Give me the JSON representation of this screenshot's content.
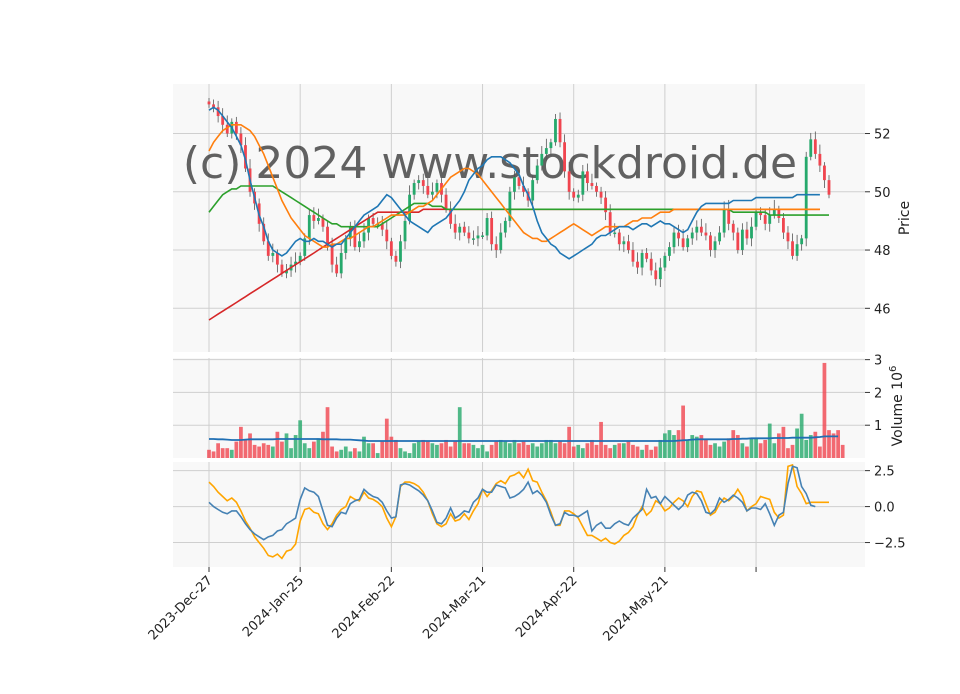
{
  "watermark": "(c) 2024 www.stockdroid.de",
  "colors": {
    "up": "#26a96c",
    "down": "#f0454f",
    "ma_short": "#1f77b4",
    "ma_mid": "#ff7f0e",
    "ma_long": "#2ca02c",
    "ma_longest": "#d62728",
    "volume_avg": "#1f6fb4",
    "macd": "#4682b4",
    "signal": "#ffa500",
    "panel_bg": "#f8f8f8",
    "grid": "#cfcfcf"
  },
  "chart_data": {
    "type": "candlestick",
    "x_ticks": [
      "2023-Dec-27",
      "2024-Jan-25",
      "2024-Feb-22",
      "2024-Mar-21",
      "2024-Apr-22",
      "2024-May-21"
    ],
    "panels": {
      "price": {
        "ylabel": "Price",
        "yticks": [
          46,
          48,
          50,
          52
        ],
        "ylim": [
          44.5,
          53.7
        ],
        "grid": true
      },
      "volume": {
        "ylabel": "Volume  10^6",
        "yticks": [
          1,
          2,
          3
        ],
        "ylim": [
          0,
          3.05
        ],
        "grid": true
      },
      "oscillator": {
        "yticks": [
          "2.5",
          "0.0",
          "−2.5"
        ],
        "ytick_values": [
          2.5,
          0,
          -2.5
        ],
        "ylim": [
          -4.2,
          3.1
        ],
        "grid": true
      }
    },
    "close": [
      53.0,
      52.9,
      52.6,
      52.3,
      52.0,
      52.4,
      52.0,
      51.6,
      50.8,
      50.0,
      49.6,
      48.9,
      48.3,
      47.8,
      47.9,
      47.5,
      47.2,
      47.3,
      47.5,
      47.6,
      47.8,
      48.4,
      49.2,
      49.0,
      49.1,
      48.8,
      48.2,
      47.5,
      47.2,
      47.9,
      48.4,
      48.8,
      48.1,
      48.3,
      48.6,
      49.1,
      48.9,
      48.9,
      48.7,
      48.3,
      47.8,
      47.6,
      48.3,
      49.0,
      49.9,
      50.3,
      50.4,
      50.2,
      49.9,
      50.0,
      50.3,
      49.9,
      49.4,
      48.9,
      48.6,
      48.8,
      48.6,
      48.4,
      48.4,
      48.5,
      48.5,
      49.1,
      48.2,
      48.0,
      48.6,
      49.0,
      50.0,
      50.5,
      50.2,
      50.0,
      49.7,
      50.4,
      50.9,
      51.3,
      51.5,
      51.7,
      52.5,
      51.7,
      50.7,
      50.0,
      49.8,
      49.9,
      50.7,
      50.3,
      50.2,
      50.0,
      49.8,
      49.3,
      48.6,
      48.6,
      48.2,
      48.3,
      48.0,
      47.6,
      47.4,
      47.9,
      47.7,
      47.3,
      47.0,
      47.4,
      47.8,
      48.1,
      48.6,
      48.4,
      48.1,
      48.4,
      48.6,
      48.8,
      48.6,
      48.5,
      48.0,
      48.3,
      48.6,
      49.4,
      48.9,
      48.6,
      48.0,
      48.7,
      48.4,
      48.8,
      49.3,
      49.2,
      48.9,
      49.2,
      49.4,
      49.1,
      48.6,
      48.3,
      47.8,
      48.2,
      48.4,
      51.2,
      51.8,
      51.3,
      50.9,
      50.4,
      49.9
    ],
    "ma_short": [
      52.8,
      52.9,
      52.8,
      52.6,
      52.4,
      52.2,
      51.9,
      51.6,
      51.1,
      50.4,
      49.8,
      49.2,
      48.8,
      48.3,
      48.0,
      47.9,
      47.8,
      47.9,
      48.1,
      48.3,
      48.4,
      48.3,
      48.3,
      48.4,
      48.3,
      48.3,
      48.2,
      48.1,
      48.2,
      48.2,
      48.4,
      48.6,
      48.8,
      49.0,
      49.2,
      49.3,
      49.4,
      49.5,
      49.7,
      49.9,
      49.8,
      49.6,
      49.4,
      49.2,
      49.0,
      48.9,
      48.8,
      48.7,
      48.6,
      48.8,
      48.9,
      49.0,
      49.1,
      49.3,
      49.5,
      49.7,
      50.0,
      50.4,
      50.6,
      50.8,
      50.9,
      51.1,
      51.2,
      51.2,
      51.2,
      51.1,
      51.0,
      50.8,
      50.6,
      50.2,
      49.9,
      49.5,
      49.0,
      48.6,
      48.4,
      48.2,
      48.1,
      47.9,
      47.8,
      47.7,
      47.8,
      47.9,
      48.0,
      48.1,
      48.2,
      48.4,
      48.5,
      48.5,
      48.6,
      48.7,
      48.8,
      48.8,
      48.8,
      48.7,
      48.8,
      48.9,
      48.9,
      48.8,
      48.9,
      49.0,
      48.9,
      48.9,
      48.8,
      48.7,
      48.6,
      48.7,
      49.0,
      49.3,
      49.5,
      49.6,
      49.6,
      49.6,
      49.6,
      49.6,
      49.6,
      49.7,
      49.7,
      49.7,
      49.7,
      49.7,
      49.8,
      49.8,
      49.8,
      49.8,
      49.8,
      49.8,
      49.8,
      49.8,
      49.8,
      49.9,
      49.9,
      49.9,
      49.9,
      49.9,
      49.9
    ],
    "ma_mid": [
      51.4,
      51.7,
      51.9,
      52.1,
      52.2,
      52.3,
      52.3,
      52.3,
      52.2,
      52.1,
      51.9,
      51.6,
      51.3,
      50.9,
      50.5,
      50.1,
      49.7,
      49.4,
      49.1,
      48.9,
      48.7,
      48.5,
      48.4,
      48.3,
      48.2,
      48.1,
      48.1,
      48.2,
      48.2,
      48.3,
      48.4,
      48.4,
      48.5,
      48.6,
      48.7,
      48.8,
      48.8,
      48.9,
      49.0,
      49.1,
      49.2,
      49.2,
      49.2,
      49.2,
      49.3,
      49.4,
      49.5,
      49.5,
      49.6,
      49.7,
      49.9,
      50.1,
      50.3,
      50.5,
      50.6,
      50.7,
      50.8,
      50.8,
      50.7,
      50.6,
      50.4,
      50.2,
      50.0,
      49.8,
      49.6,
      49.4,
      49.2,
      49.0,
      48.8,
      48.6,
      48.5,
      48.4,
      48.4,
      48.3,
      48.3,
      48.4,
      48.5,
      48.6,
      48.7,
      48.8,
      48.9,
      48.8,
      48.7,
      48.6,
      48.5,
      48.6,
      48.7,
      48.8,
      48.8,
      48.8,
      48.8,
      48.8,
      48.9,
      49.0,
      49.0,
      49.1,
      49.1,
      49.1,
      49.2,
      49.3,
      49.3,
      49.3,
      49.4,
      49.4,
      49.4,
      49.4,
      49.4,
      49.4,
      49.4,
      49.4,
      49.4,
      49.4,
      49.4,
      49.4,
      49.4,
      49.4,
      49.4,
      49.4,
      49.4,
      49.4,
      49.4,
      49.4,
      49.4,
      49.4,
      49.4,
      49.4,
      49.4,
      49.4,
      49.4,
      49.4,
      49.4,
      49.4,
      49.4,
      49.4,
      49.4
    ],
    "ma_long": [
      49.3,
      49.5,
      49.7,
      49.9,
      50.0,
      50.1,
      50.1,
      50.2,
      50.2,
      50.2,
      50.2,
      50.2,
      50.2,
      50.2,
      50.2,
      50.1,
      50.0,
      49.9,
      49.8,
      49.7,
      49.6,
      49.5,
      49.4,
      49.3,
      49.2,
      49.1,
      49.0,
      48.9,
      48.9,
      48.8,
      48.8,
      48.8,
      48.8,
      48.8,
      48.8,
      48.8,
      48.8,
      48.8,
      48.9,
      49.0,
      49.1,
      49.2,
      49.3,
      49.4,
      49.5,
      49.6,
      49.6,
      49.6,
      49.6,
      49.5,
      49.5,
      49.5,
      49.4,
      49.4,
      49.4,
      49.4,
      49.4,
      49.4,
      49.4,
      49.4,
      49.4,
      49.4,
      49.4,
      49.4,
      49.4,
      49.4,
      49.4,
      49.4,
      49.4,
      49.4,
      49.4,
      49.4,
      49.4,
      49.4,
      49.4,
      49.4,
      49.4,
      49.4,
      49.4,
      49.4,
      49.4,
      49.4,
      49.4,
      49.4,
      49.4,
      49.4,
      49.4,
      49.4,
      49.4,
      49.4,
      49.4,
      49.4,
      49.4,
      49.4,
      49.4,
      49.4,
      49.4,
      49.4,
      49.4,
      49.4,
      49.4,
      49.4,
      49.4,
      49.4,
      49.4,
      49.4,
      49.4,
      49.4,
      49.4,
      49.4,
      49.4,
      49.4,
      49.4,
      49.4,
      49.4,
      49.3,
      49.3,
      49.3,
      49.3,
      49.3,
      49.3,
      49.3,
      49.3,
      49.2,
      49.2,
      49.2,
      49.2,
      49.2,
      49.2,
      49.2,
      49.2,
      49.2,
      49.2,
      49.2,
      49.2,
      49.2,
      49.2
    ],
    "ma_longest": [
      45.6,
      45.7,
      45.8,
      45.9,
      46.0,
      46.1,
      46.2,
      46.3,
      46.4,
      46.5,
      46.6,
      46.7,
      46.8,
      46.9,
      47.0,
      47.1,
      47.2,
      47.3,
      47.4,
      47.5,
      47.6,
      47.7,
      47.8,
      47.9,
      48.0,
      48.1,
      48.2,
      48.3,
      48.4,
      48.5,
      48.6,
      48.7,
      48.8,
      48.9,
      49.0,
      49.1,
      49.2,
      49.3,
      49.3,
      49.3,
      49.3,
      49.3,
      49.3,
      49.3,
      49.3,
      49.3,
      49.3,
      49.4,
      49.4,
      49.4,
      49.4,
      49.4,
      49.4,
      49.4,
      49.4,
      49.4,
      49.4,
      49.4,
      49.4,
      49.4,
      49.4,
      49.4,
      49.4,
      49.4,
      49.4,
      49.4,
      49.4,
      49.4,
      49.4,
      49.4,
      49.4,
      49.4,
      49.4,
      49.4,
      49.4,
      49.4,
      49.4,
      49.4,
      49.4,
      49.4,
      49.4,
      49.4,
      49.4,
      49.4,
      49.4,
      49.4,
      49.4,
      49.4,
      49.4,
      49.4,
      49.4,
      49.4,
      49.4,
      49.4,
      49.4,
      49.4,
      49.4,
      49.4,
      49.4,
      49.4,
      49.4,
      49.4,
      49.4,
      49.4,
      49.4,
      49.4,
      49.4,
      49.4,
      49.4,
      49.4,
      49.4,
      49.4,
      49.4,
      49.4,
      49.4,
      49.4,
      49.4,
      49.4,
      49.4,
      49.4,
      49.4,
      49.4,
      49.4,
      49.4,
      49.4,
      49.4,
      49.4,
      49.4,
      49.4,
      49.4,
      49.4,
      49.4,
      49.4,
      49.4,
      49.4
    ],
    "volume": [
      0.25,
      0.2,
      0.45,
      0.3,
      0.3,
      0.25,
      0.5,
      0.95,
      0.55,
      0.75,
      0.4,
      0.35,
      0.45,
      0.4,
      0.35,
      0.8,
      0.5,
      0.75,
      0.3,
      0.7,
      1.15,
      0.45,
      0.3,
      0.5,
      0.6,
      0.8,
      1.55,
      0.35,
      0.2,
      0.25,
      0.35,
      0.2,
      0.3,
      0.2,
      0.65,
      0.45,
      0.45,
      0.15,
      0.5,
      1.2,
      0.65,
      0.55,
      0.3,
      0.2,
      0.15,
      0.45,
      0.5,
      0.55,
      0.5,
      0.45,
      0.4,
      0.45,
      0.55,
      0.35,
      0.5,
      1.55,
      0.45,
      0.45,
      0.4,
      0.3,
      0.4,
      0.2,
      0.4,
      0.5,
      0.55,
      0.5,
      0.45,
      0.55,
      0.45,
      0.5,
      0.4,
      0.45,
      0.35,
      0.45,
      0.55,
      0.55,
      0.45,
      0.5,
      0.45,
      0.95,
      0.35,
      0.4,
      0.3,
      0.45,
      0.55,
      0.4,
      1.1,
      0.4,
      0.3,
      0.4,
      0.45,
      0.45,
      0.5,
      0.4,
      0.35,
      0.25,
      0.4,
      0.25,
      0.35,
      0.55,
      0.75,
      0.85,
      0.7,
      0.85,
      1.6,
      0.55,
      0.7,
      0.65,
      0.7,
      0.55,
      0.4,
      0.45,
      0.35,
      0.5,
      0.6,
      0.85,
      0.7,
      0.45,
      0.35,
      0.6,
      0.6,
      0.45,
      0.55,
      1.05,
      0.45,
      0.75,
      0.95,
      0.3,
      0.4,
      0.9,
      1.35,
      0.55,
      0.7,
      0.8,
      0.35,
      2.9,
      0.85,
      0.75,
      0.85,
      0.4
    ],
    "volume_avg": [
      0.58,
      0.58,
      0.57,
      0.57,
      0.56,
      0.55,
      0.55,
      0.55,
      0.56,
      0.57,
      0.57,
      0.57,
      0.57,
      0.57,
      0.57,
      0.58,
      0.58,
      0.58,
      0.58,
      0.58,
      0.58,
      0.58,
      0.58,
      0.58,
      0.58,
      0.57,
      0.57,
      0.57,
      0.57,
      0.56,
      0.56,
      0.56,
      0.55,
      0.54,
      0.53,
      0.52,
      0.52,
      0.52,
      0.52,
      0.52,
      0.52,
      0.52,
      0.52,
      0.52,
      0.52,
      0.52,
      0.52,
      0.52,
      0.52,
      0.52,
      0.52,
      0.52,
      0.52,
      0.52,
      0.52,
      0.52,
      0.52,
      0.52,
      0.52,
      0.52,
      0.52,
      0.52,
      0.52,
      0.52,
      0.52,
      0.52,
      0.52,
      0.52,
      0.52,
      0.52,
      0.52,
      0.52,
      0.52,
      0.52,
      0.52,
      0.52,
      0.52,
      0.52,
      0.52,
      0.52,
      0.52,
      0.52,
      0.52,
      0.52,
      0.52,
      0.52,
      0.52,
      0.52,
      0.52,
      0.52,
      0.52,
      0.52,
      0.52,
      0.52,
      0.52,
      0.52,
      0.52,
      0.52,
      0.52,
      0.52,
      0.52,
      0.52,
      0.52,
      0.53,
      0.54,
      0.55,
      0.56,
      0.57,
      0.57,
      0.57,
      0.57,
      0.57,
      0.57,
      0.57,
      0.57,
      0.58,
      0.58,
      0.59,
      0.59,
      0.6,
      0.6,
      0.6,
      0.6,
      0.6,
      0.61,
      0.61,
      0.61,
      0.61,
      0.62,
      0.62,
      0.62,
      0.62,
      0.62,
      0.63,
      0.64,
      0.66,
      0.66,
      0.66,
      0.66
    ],
    "macd": [
      0.3,
      0.0,
      -0.2,
      -0.4,
      -0.5,
      -0.3,
      -0.3,
      -0.7,
      -1.2,
      -1.6,
      -1.9,
      -2.1,
      -2.3,
      -2.1,
      -2.0,
      -1.7,
      -1.6,
      -1.2,
      -1.0,
      -0.8,
      0.5,
      1.3,
      1.1,
      1.0,
      0.7,
      -0.3,
      -1.3,
      -1.4,
      -0.8,
      -0.4,
      -0.5,
      0.2,
      0.4,
      0.5,
      1.2,
      0.9,
      0.7,
      0.6,
      0.3,
      -0.3,
      -0.8,
      -0.7,
      1.5,
      1.6,
      1.5,
      1.3,
      1.1,
      0.8,
      0.4,
      -0.3,
      -1.1,
      -1.2,
      -0.8,
      -0.1,
      -0.8,
      -0.6,
      -0.3,
      -0.4,
      0.3,
      0.6,
      1.2,
      1.0,
      1.0,
      1.5,
      1.4,
      1.3,
      0.6,
      0.7,
      0.9,
      1.2,
      1.7,
      0.9,
      1.1,
      0.8,
      0.3,
      -0.6,
      -1.3,
      -1.2,
      -0.4,
      -0.6,
      -0.6,
      -0.7,
      -0.5,
      -0.3,
      -1.7,
      -1.3,
      -1.1,
      -1.5,
      -1.5,
      -1.2,
      -1.0,
      -1.2,
      -1.3,
      -0.8,
      -0.5,
      -0.2,
      1.2,
      0.6,
      0.7,
      0.2,
      0.7,
      0.4,
      0.1,
      -0.2,
      0.1,
      0.8,
      1.0,
      0.9,
      0.4,
      -0.4,
      -0.5,
      -0.2,
      0.6,
      0.3,
      0.5,
      0.8,
      0.6,
      0.3,
      -0.3,
      -0.1,
      -0.1,
      -0.2,
      0.2,
      -0.5,
      -1.3,
      -0.6,
      -0.4,
      1.6,
      2.8,
      2.7,
      1.4,
      0.9,
      0.1,
      0.0
    ],
    "signal": [
      1.7,
      1.4,
      1.0,
      0.7,
      0.4,
      0.6,
      0.3,
      -0.3,
      -1.0,
      -1.5,
      -2.1,
      -2.5,
      -2.9,
      -3.4,
      -3.5,
      -3.3,
      -3.6,
      -3.1,
      -3.0,
      -2.6,
      -1.0,
      -0.2,
      -0.1,
      -0.4,
      -0.5,
      -1.2,
      -1.6,
      -1.2,
      -0.6,
      -0.2,
      0.0,
      0.7,
      0.5,
      0.4,
      1.0,
      0.6,
      0.5,
      0.3,
      0.0,
      -0.8,
      -1.4,
      -0.7,
      1.4,
      1.7,
      1.7,
      1.6,
      1.4,
      1.0,
      0.4,
      -0.5,
      -1.2,
      -1.4,
      -1.2,
      -0.5,
      -1.0,
      -0.9,
      -0.5,
      -0.9,
      -0.3,
      0.2,
      1.2,
      0.7,
      1.1,
      1.6,
      1.8,
      1.6,
      2.1,
      2.2,
      2.4,
      2.0,
      2.6,
      1.8,
      1.7,
      1.0,
      0.4,
      -0.4,
      -1.3,
      -1.3,
      -0.3,
      -0.3,
      -0.5,
      -0.8,
      -1.4,
      -2.0,
      -2.0,
      -2.2,
      -2.4,
      -2.2,
      -2.5,
      -2.6,
      -2.4,
      -2.0,
      -1.8,
      -1.4,
      -0.6,
      0.0,
      -0.6,
      -0.3,
      0.4,
      0.2,
      -0.3,
      -0.1,
      0.3,
      0.6,
      0.4,
      0.0,
      0.7,
      1.1,
      1.0,
      0.2,
      -0.6,
      -0.4,
      0.2,
      0.6,
      0.4,
      0.7,
      1.2,
      0.7,
      -0.3,
      0.0,
      0.2,
      0.7,
      0.6,
      0.5,
      -0.4,
      -0.8,
      -0.6,
      2.8,
      2.9,
      1.4,
      0.9,
      0.2,
      0.3,
      0.3,
      0.3,
      0.3,
      0.3
    ]
  }
}
